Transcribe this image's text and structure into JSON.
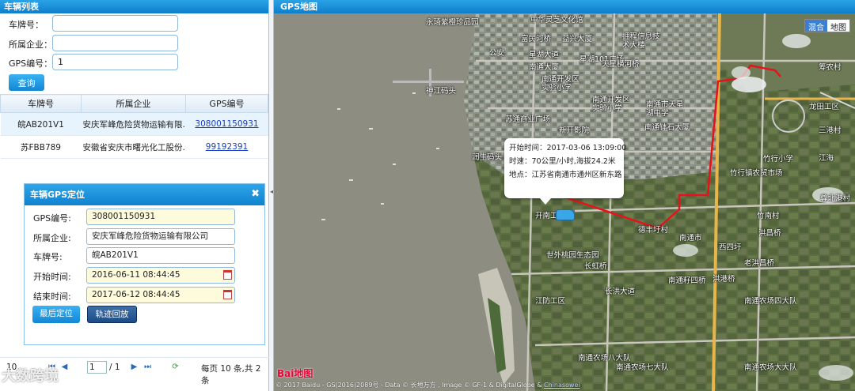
{
  "left_panel": {
    "title": "车辆列表",
    "filters": {
      "plate_label": "车牌号：",
      "plate_value": "",
      "company_label": "所属企业：",
      "company_value": "",
      "gps_label": "GPS编号：",
      "gps_value": "1"
    },
    "query_button": "查询",
    "table": {
      "columns": [
        "车牌号",
        "所属企业",
        "GPS编号"
      ],
      "rows": [
        {
          "plate": "皖AB201V1",
          "company": "安庆军峰危险货物运输有限...",
          "gps": "308001150931",
          "selected": true
        },
        {
          "plate": "苏FBB789",
          "company": "安徽省安庆市曙光化工股份...",
          "gps": "99192391",
          "selected": false
        }
      ]
    }
  },
  "dialog": {
    "title": "车辆GPS定位",
    "close_icon": "close-icon",
    "gps_label": "GPS编号:",
    "gps_value": "308001150931",
    "company_label": "所属企业:",
    "company_value": "安庆军峰危险货物运输有限公司",
    "plate_label": "车牌号:",
    "plate_value": "皖AB201V1",
    "start_label": "开始时间:",
    "start_value": "2016-06-11 08:44:45",
    "end_label": "结束时间:",
    "end_value": "2017-06-12 08:44:45",
    "locate_button": "最后定位",
    "replay_button": "轨迹回放"
  },
  "pager": {
    "page_size": "10",
    "page_input": "1",
    "total_pages": "/ 1",
    "summary": "每页 10 条,共 2 条",
    "icons": [
      "first-page-icon",
      "prev-page-icon",
      "next-page-icon",
      "last-page-icon",
      "refresh-icon"
    ]
  },
  "watermark": "大数跨境",
  "map_panel": {
    "title": "GPS地图",
    "map_type": {
      "hybrid": "混合",
      "map": "地图",
      "active": "hybrid"
    },
    "info_window": {
      "start_time": "开始时间：2017-03-06 13:09:00",
      "speed": "时速：70公里/小时,海拔24.2米",
      "location": "地点：江苏省南通市通州区新东路"
    },
    "route_color": "#e8121b",
    "labels": [
      "永琦紫橙珍品园",
      "中华灵芝文化馆",
      "富民河桥",
      "益兴大厦",
      "拥程信息技术大楼",
      "公安",
      "星湖大道",
      "南通大厦",
      "星湖101广场",
      "天星横河桥",
      "神江码头",
      "南通开发区实验小学",
      "南通开发区实验小学",
      "南通市天星湖中学",
      "苏通商业广场",
      "新开影院",
      "南通钵石大厦",
      "润生码头",
      "竹行小学",
      "竹行镇农贸市场",
      "开南工区",
      "德丰圩村",
      "南通市",
      "洪昌桥",
      "世外桃园生态园",
      "长虹桥",
      "西四圩",
      "老洪昌桥",
      "南通籽四桥",
      "洪港桥",
      "江防工区",
      "长洪大道",
      "南通农场四大队",
      "南通农场八大队",
      "南通农场七大队",
      "南通农场大大队",
      "筹农村",
      "龙田工区",
      "三港村",
      "江海",
      "尊北港村",
      "竹南村"
    ],
    "copyright": "© 2017 Baidu - GS(2016)2089号 - Data © 长地万方 , Image © GF-1 & DigitalGlobe &",
    "copyright_link": "Chinasowei",
    "logo": "Bai地图"
  }
}
